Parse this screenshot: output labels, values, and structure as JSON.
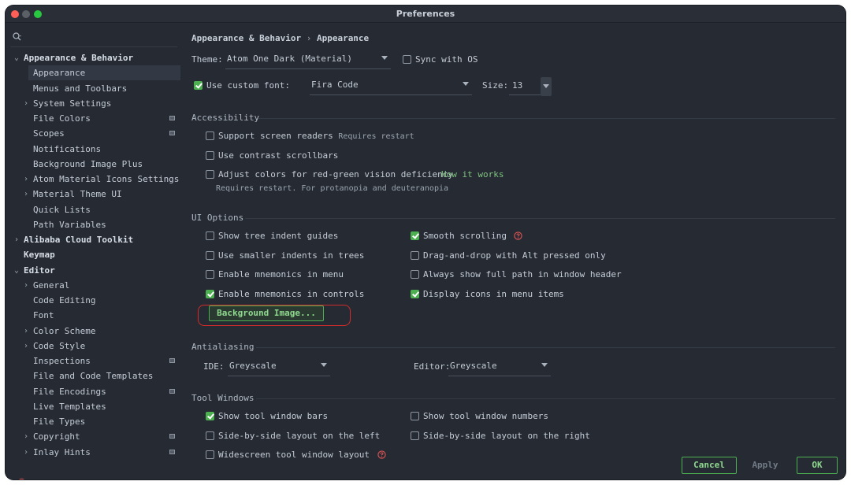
{
  "window": {
    "title": "Preferences"
  },
  "search": {
    "icon": "search-icon",
    "value": ""
  },
  "sidebar": {
    "items": [
      {
        "label": "Appearance & Behavior",
        "arrow": "⌄",
        "bold": true,
        "badge": false,
        "selected": false
      },
      {
        "label": "Appearance",
        "arrow": "",
        "bold": false,
        "badge": false,
        "selected": true
      },
      {
        "label": "Menus and Toolbars",
        "arrow": "",
        "bold": false,
        "badge": false,
        "selected": false
      },
      {
        "label": "System Settings",
        "arrow": "›",
        "bold": false,
        "badge": false,
        "selected": false
      },
      {
        "label": "File Colors",
        "arrow": "",
        "bold": false,
        "badge": true,
        "selected": false
      },
      {
        "label": "Scopes",
        "arrow": "",
        "bold": false,
        "badge": true,
        "selected": false
      },
      {
        "label": "Notifications",
        "arrow": "",
        "bold": false,
        "badge": false,
        "selected": false
      },
      {
        "label": "Background Image Plus",
        "arrow": "",
        "bold": false,
        "badge": false,
        "selected": false
      },
      {
        "label": "Atom Material Icons Settings",
        "arrow": "›",
        "bold": false,
        "badge": false,
        "selected": false
      },
      {
        "label": "Material Theme UI",
        "arrow": "›",
        "bold": false,
        "badge": false,
        "selected": false
      },
      {
        "label": "Quick Lists",
        "arrow": "",
        "bold": false,
        "badge": false,
        "selected": false
      },
      {
        "label": "Path Variables",
        "arrow": "",
        "bold": false,
        "badge": false,
        "selected": false
      },
      {
        "label": "Alibaba Cloud Toolkit",
        "arrow": "›",
        "bold": true,
        "badge": false,
        "selected": false
      },
      {
        "label": "Keymap",
        "arrow": "",
        "bold": true,
        "badge": false,
        "selected": false
      },
      {
        "label": "Editor",
        "arrow": "⌄",
        "bold": true,
        "badge": false,
        "selected": false
      },
      {
        "label": "General",
        "arrow": "›",
        "bold": false,
        "badge": false,
        "selected": false
      },
      {
        "label": "Code Editing",
        "arrow": "",
        "bold": false,
        "badge": false,
        "selected": false
      },
      {
        "label": "Font",
        "arrow": "",
        "bold": false,
        "badge": false,
        "selected": false
      },
      {
        "label": "Color Scheme",
        "arrow": "›",
        "bold": false,
        "badge": false,
        "selected": false
      },
      {
        "label": "Code Style",
        "arrow": "›",
        "bold": false,
        "badge": false,
        "selected": false
      },
      {
        "label": "Inspections",
        "arrow": "",
        "bold": false,
        "badge": true,
        "selected": false
      },
      {
        "label": "File and Code Templates",
        "arrow": "",
        "bold": false,
        "badge": false,
        "selected": false
      },
      {
        "label": "File Encodings",
        "arrow": "",
        "bold": false,
        "badge": true,
        "selected": false
      },
      {
        "label": "Live Templates",
        "arrow": "",
        "bold": false,
        "badge": false,
        "selected": false
      },
      {
        "label": "File Types",
        "arrow": "",
        "bold": false,
        "badge": false,
        "selected": false
      },
      {
        "label": "Copyright",
        "arrow": "›",
        "bold": false,
        "badge": true,
        "selected": false
      },
      {
        "label": "Inlay Hints",
        "arrow": "›",
        "bold": false,
        "badge": true,
        "selected": false
      }
    ]
  },
  "breadcrumb": {
    "parent": "Appearance & Behavior",
    "separator": "›",
    "current": "Appearance"
  },
  "theme": {
    "label": "Theme:",
    "value": "Atom One Dark (Material)",
    "sync_label": "Sync with OS",
    "sync_checked": false
  },
  "font": {
    "checkbox_label": "Use custom font:",
    "checked": true,
    "value": "Fira Code",
    "size_label": "Size:",
    "size_value": "13"
  },
  "accessibility": {
    "title": "Accessibility",
    "screen_readers": {
      "label": "Support screen readers",
      "hint": "Requires restart",
      "checked": false
    },
    "contrast_scrollbars": {
      "label": "Use contrast scrollbars",
      "checked": false
    },
    "red_green": {
      "label": "Adjust colors for red-green vision deficiency",
      "link": "How it works",
      "note": "Requires restart. For protanopia and deuteranopia",
      "checked": false
    }
  },
  "ui_options": {
    "title": "UI Options",
    "left": [
      {
        "label": "Show tree indent guides",
        "checked": false
      },
      {
        "label": "Use smaller indents in trees",
        "checked": false
      },
      {
        "label": "Enable mnemonics in menu",
        "checked": false
      },
      {
        "label": "Enable mnemonics in controls",
        "checked": true
      }
    ],
    "right": [
      {
        "label": "Smooth scrolling",
        "checked": true,
        "help": true
      },
      {
        "label": "Drag-and-drop with Alt pressed only",
        "checked": false,
        "help": false
      },
      {
        "label": "Always show full path in window header",
        "checked": false,
        "help": false
      },
      {
        "label": "Display icons in menu items",
        "checked": true,
        "help": false
      }
    ],
    "background_button": "Background Image..."
  },
  "antialiasing": {
    "title": "Antialiasing",
    "ide_label": "IDE:",
    "ide_value": "Greyscale",
    "editor_label": "Editor:",
    "editor_value": "Greyscale"
  },
  "tool_windows": {
    "title": "Tool Windows",
    "left": [
      {
        "label": "Show tool window bars",
        "checked": true
      },
      {
        "label": "Side-by-side layout on the left",
        "checked": false
      },
      {
        "label": "Widescreen tool window layout",
        "checked": false,
        "help": true
      }
    ],
    "right": [
      {
        "label": "Show tool window numbers",
        "checked": false
      },
      {
        "label": "Side-by-side layout on the right",
        "checked": false
      }
    ]
  },
  "footer": {
    "cancel": "Cancel",
    "apply": "Apply",
    "ok": "OK",
    "help_icon": "question-circle-icon"
  },
  "colors": {
    "accent": "#4caf50",
    "link": "#7ec27f",
    "help": "#e05555",
    "highlight_outline": "#d12b2b",
    "background": "#262b33"
  }
}
